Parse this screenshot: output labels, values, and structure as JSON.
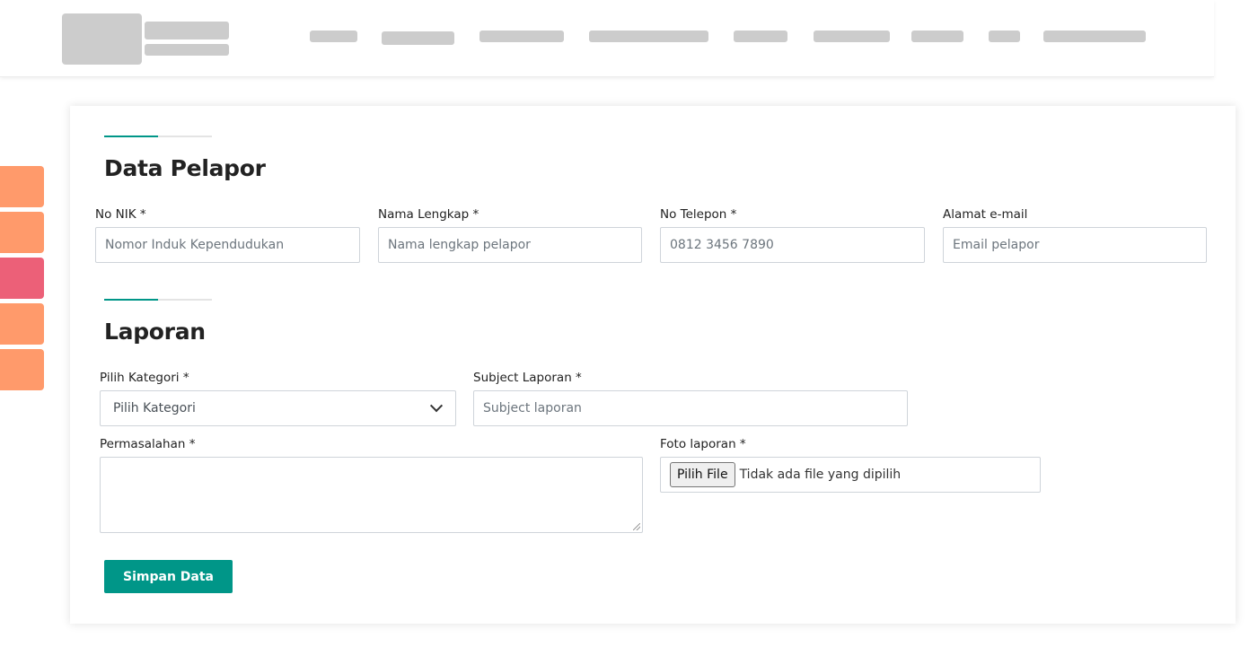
{
  "colors": {
    "accent": "#009688",
    "side_tab_orange": "#ff9a6b",
    "side_tab_pink": "#ec6078",
    "placeholder_gray": "#cccccc"
  },
  "reporter_section": {
    "title": "Data Pelapor",
    "fields": [
      {
        "label": "No NIK *",
        "placeholder": "Nomor Induk Kependudukan"
      },
      {
        "label": "Nama Lengkap *",
        "placeholder": "Nama lengkap pelapor"
      },
      {
        "label": "No Telepon *",
        "placeholder": "0812 3456 7890"
      },
      {
        "label": "Alamat e-mail",
        "placeholder": "Email pelapor"
      }
    ]
  },
  "report_section": {
    "title": "Laporan",
    "category": {
      "label": "Pilih Kategori *",
      "selected": "Pilih Kategori"
    },
    "subject": {
      "label": "Subject Laporan *",
      "placeholder": "Subject laporan"
    },
    "problem": {
      "label": "Permasalahan *",
      "value": ""
    },
    "photo": {
      "label": "Foto laporan *",
      "button": "Pilih File",
      "status": "Tidak ada file yang dipilih"
    },
    "submit_label": "Simpan Data"
  }
}
